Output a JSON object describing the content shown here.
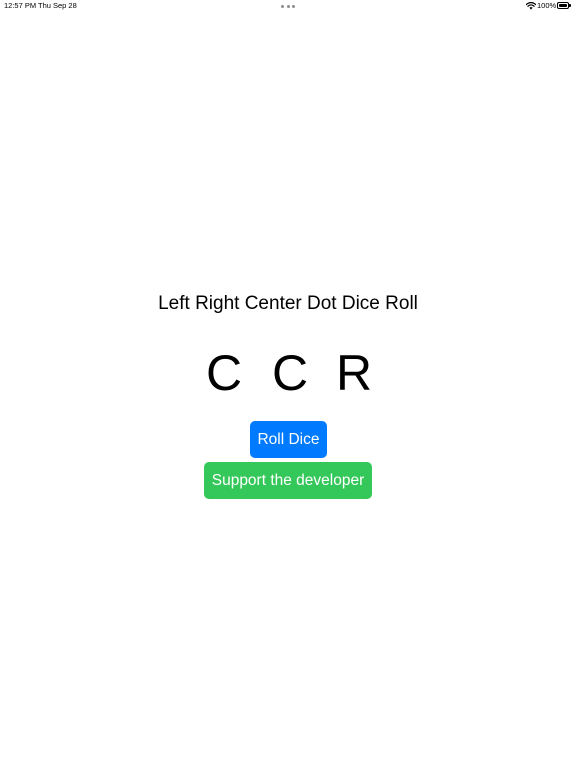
{
  "status_bar": {
    "time": "12:57 PM",
    "date": "Thu Sep 28",
    "battery_percent": "100%",
    "battery_level": 1.0,
    "icons": [
      "wifi-icon",
      "battery-icon",
      "multitasking-dots-icon"
    ]
  },
  "main": {
    "title": "Left Right Center Dot Dice Roll",
    "dice": [
      "C",
      "C",
      "R"
    ],
    "roll_button_label": "Roll Dice",
    "support_button_label": "Support the developer"
  },
  "colors": {
    "background": "#ffffff",
    "roll_button": "#007aff",
    "support_button": "#34c759",
    "text": "#000000"
  }
}
